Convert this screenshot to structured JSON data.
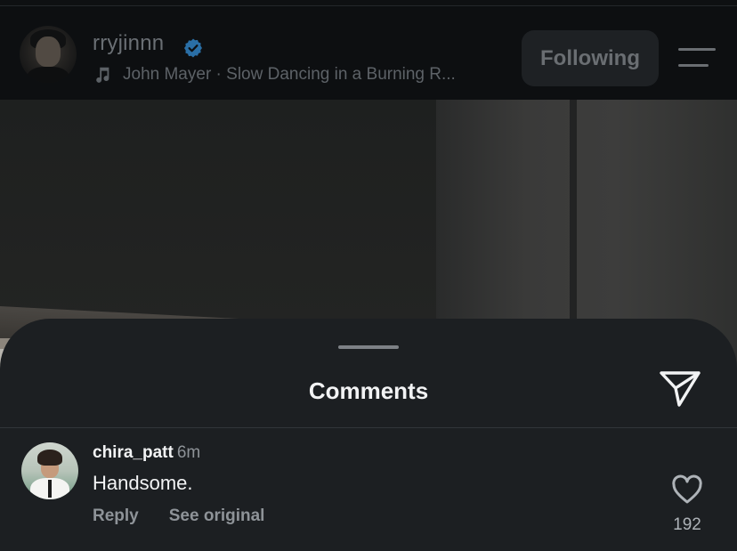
{
  "post_header": {
    "username": "rryjinnn",
    "verified": true,
    "music": "John Mayer · Slow Dancing in a Burning R...",
    "follow_label": "Following",
    "icons": {
      "verified": "verified-badge-icon",
      "music": "music-note-icon",
      "menu": "menu-icon"
    }
  },
  "comments_sheet": {
    "title": "Comments",
    "share_icon": "send-icon",
    "comments": [
      {
        "username": "chira_patt",
        "time": "6m",
        "text": "Handsome.",
        "reply_label": "Reply",
        "see_original_label": "See original",
        "like_count": "192",
        "like_icon": "heart-icon"
      }
    ]
  },
  "colors": {
    "sheet_background": "#1c1f22",
    "text_primary": "#f2f3f4",
    "text_secondary": "#8e9398",
    "verified_blue": "#2a6fa6"
  }
}
